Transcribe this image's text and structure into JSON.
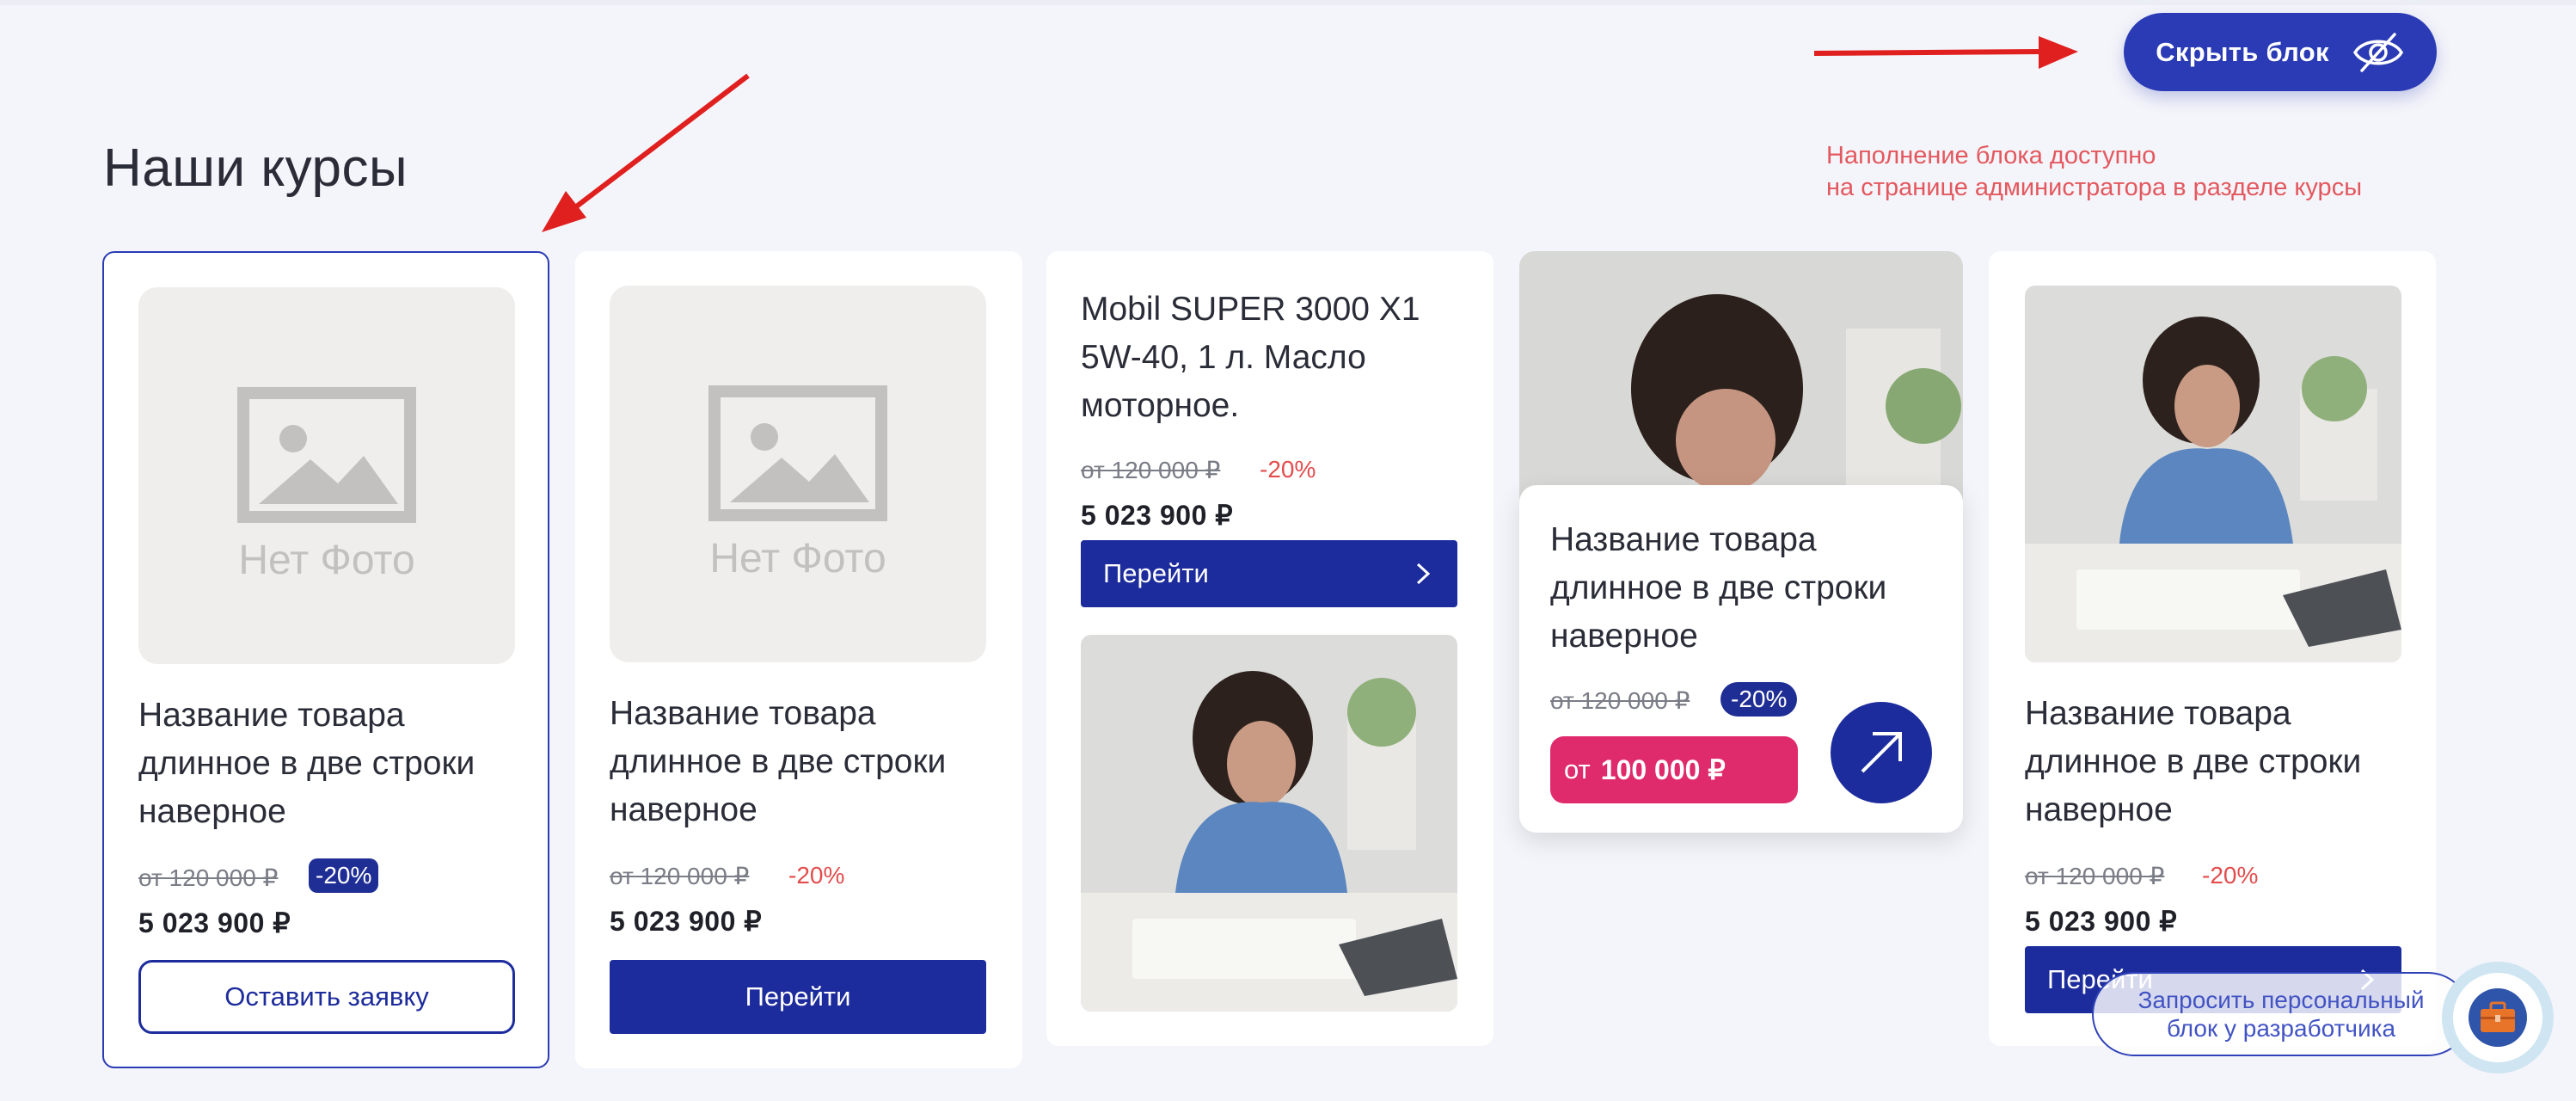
{
  "section": {
    "title": "Наши курсы"
  },
  "hide_block": {
    "label": "Скрыть блок",
    "icon": "eye-off-icon"
  },
  "admin_note": {
    "line1": "Наполнение блока доступно",
    "line2": "на странице администратора в разделе курсы",
    "color": "#e3585e"
  },
  "no_photo_text": "Нет Фото",
  "cards": [
    {
      "title": "Название товара длинное в две строки наверное",
      "old_price": "от 120 000 ₽",
      "discount": "-20%",
      "price": "5 023 900 ₽",
      "button": "Оставить заявку"
    },
    {
      "title": "Название товара длинное в две строки наверное",
      "old_price": "от 120 000 ₽",
      "discount": "-20%",
      "price": "5 023 900 ₽",
      "button": "Перейти"
    },
    {
      "title": "Mobil SUPER 3000 X1 5W-40, 1 л. Масло моторное.",
      "old_price": "от 120 000 ₽",
      "discount": "-20%",
      "price": "5 023 900 ₽",
      "button": "Перейти"
    },
    {
      "title": "Название товара длинное в две строки наверное",
      "old_price": "от 120 000 ₽",
      "discount": "-20%",
      "from_label": "от",
      "price": "100 000 ₽"
    },
    {
      "title": "Название товара длинное в две строки наверное",
      "old_price": "от 120 000 ₽",
      "discount": "-20%",
      "price": "5 023 900 ₽",
      "button": "Перейти"
    }
  ],
  "request": {
    "line1": "Запросить персональный",
    "line2": "блок у разработчика",
    "icon": "toolbox-icon"
  },
  "colors": {
    "accent": "#1d2c9c",
    "pink": "#df2a6b",
    "discount_red": "#e34d4d",
    "arrow_red": "#e01f1f"
  }
}
